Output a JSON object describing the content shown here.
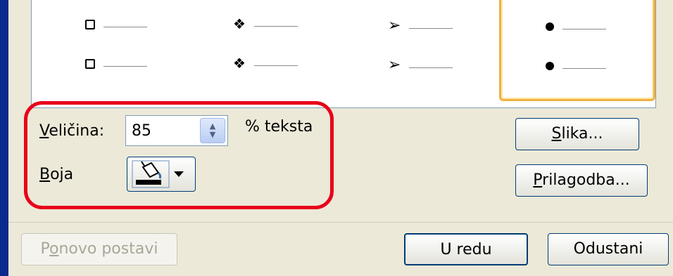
{
  "gallery": {
    "items": [
      {
        "symbol": "checkbox-square"
      },
      {
        "symbol": "four-diamond"
      },
      {
        "symbol": "arrowhead"
      },
      {
        "symbol": "round-dot"
      }
    ],
    "selected_index": 3
  },
  "size": {
    "label_underlined": "V",
    "label_rest": "eličina:",
    "value": "85",
    "suffix": "% teksta"
  },
  "color": {
    "label_underlined": "B",
    "label_rest": "oja",
    "icon": "paint-bucket-icon",
    "current_color": "#000000"
  },
  "buttons": {
    "picture_underlined": "S",
    "picture_rest": "lika...",
    "customize_underlined": "P",
    "customize_rest": "rilagodba...",
    "reset_pre": "P",
    "reset_underlined": "o",
    "reset_rest": "novo postavi",
    "ok": "U redu",
    "cancel": "Odustani"
  },
  "annotation": {
    "highlight_color": "#e8001a"
  }
}
